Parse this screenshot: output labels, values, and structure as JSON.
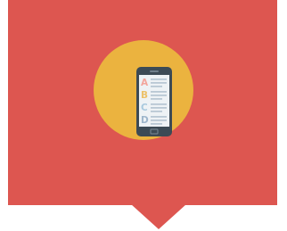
{
  "hero": {
    "icon": "mobile-quiz-icon",
    "options": [
      {
        "letter": "A",
        "color": "#f3a59c"
      },
      {
        "letter": "B",
        "color": "#ecc16b"
      },
      {
        "letter": "C",
        "color": "#a9c9de"
      },
      {
        "letter": "D",
        "color": "#9eb6cc"
      }
    ]
  },
  "colors": {
    "banner": "#dd5650",
    "circle": "#ebb33f",
    "phone_body": "#3c4a55",
    "screen": "#eef2f5",
    "lines": "#b9c8d4"
  }
}
